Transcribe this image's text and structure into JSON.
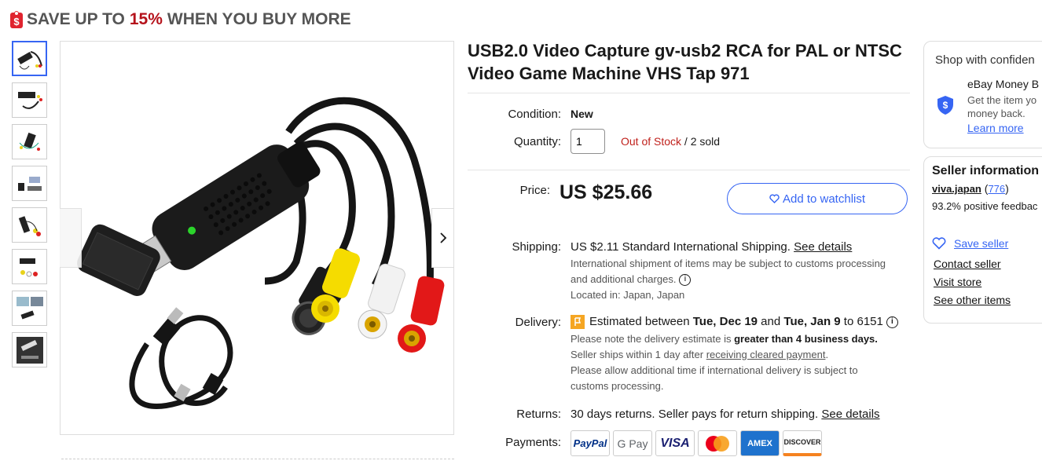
{
  "promo": {
    "pre": "SAVE UP TO",
    "pct": "15%",
    "post": "WHEN YOU BUY MORE"
  },
  "title": "USB2.0 Video Capture gv-usb2 RCA for PAL or NTSC Video Game Machine VHS Tap 971",
  "condition": {
    "label": "Condition:",
    "value": "New"
  },
  "quantity": {
    "label": "Quantity:",
    "value": "1",
    "stock": "Out of Stock",
    "sold": " / 2 sold"
  },
  "price": {
    "label": "Price:",
    "value": "US $25.66"
  },
  "watchlist": "Add to watchlist",
  "shipping": {
    "label": "Shipping:",
    "cost": "US $2.11",
    "method": " Standard International Shipping. ",
    "details": "See details",
    "note1": "International shipment of items may be subject to customs processing",
    "note2": "and additional charges.",
    "located": "Located in: Japan, Japan"
  },
  "delivery": {
    "label": "Delivery:",
    "pre": "Estimated between ",
    "d1": "Tue, Dec 19",
    "mid": " and ",
    "d2": "Tue, Jan 9",
    "post": " to 6151",
    "n1pre": "Please note the delivery estimate is ",
    "n1b": "greater than 4 business days.",
    "n2pre": "Seller ships within 1 day after ",
    "n2link": "receiving cleared payment",
    "n2post": ".",
    "n3": "Please allow additional time if international delivery is subject to",
    "n4": "customs processing."
  },
  "returns": {
    "label": "Returns:",
    "text": "30 days returns. Seller pays for return shipping. ",
    "details": "See details"
  },
  "payments": {
    "label": "Payments:",
    "methods": [
      "PayPal",
      "G Pay",
      "VISA",
      "Mastercard",
      "AMEX",
      "DISCOVER"
    ]
  },
  "shop": {
    "title": "Shop with confiden",
    "item": "eBay Money B",
    "desc1": "Get the item yo",
    "desc2": "money back.",
    "learn": "Learn more"
  },
  "seller": {
    "title": "Seller information",
    "name": "viva.japan",
    "count": "776",
    "feedback": "93.2% positive feedbac",
    "save": "Save seller",
    "contact": "Contact seller",
    "visit": "Visit store",
    "other": "See other items"
  },
  "colors": {
    "accent": "#3665f3",
    "red": "#c0211c",
    "promoRed": "#b5121b"
  }
}
